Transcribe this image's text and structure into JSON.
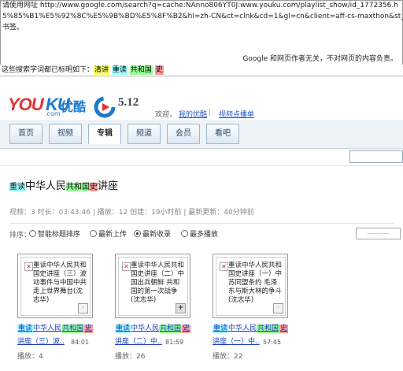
{
  "cache": {
    "url_lines": [
      "请使用网址 http://www.google.com/search?q=cache:NAnno806YT0J:www.youku.com/playlist_show/id_1772356.h",
      "5%85%B1%E5%92%8C%E5%9B%BD%E5%8F%B2&hl=zh-CN&ct=clnk&cd=1&gl=cn&client=aff-cs-maxthon&st_",
      "书签。"
    ],
    "disclaimer": "Google 和网页作者无关，不对网页的内容负责。",
    "terms_label": "这些搜索字词都已标明如下：",
    "terms": [
      "清讲",
      "重读",
      "共和国",
      "史"
    ]
  },
  "header": {
    "logo_you": "YOU",
    "logo_ku": "KU",
    "logo_cn": "优酷",
    "logo_com": ".com",
    "event_date": "5.12",
    "welcome": "欢迎，",
    "my_youku": "我的优酷",
    "separator": "|",
    "video_on_demand": "视频点播单"
  },
  "nav": {
    "tabs": [
      "首页",
      "视频",
      "专辑",
      "频道",
      "会员",
      "看吧"
    ],
    "active": "专辑"
  },
  "playlist": {
    "title_parts": [
      "重读",
      "中华人民",
      "共和国",
      "史",
      "讲座"
    ],
    "meta": "视频：3  时长：03:43:46  |  播放：12  创建：19小时前  |  最新更新：40分钟前"
  },
  "sort": {
    "label": "排序：",
    "options": [
      "智能标题排序",
      "最新上传",
      "最新收录",
      "最多播放"
    ],
    "selected": "最新收录",
    "select_value": "————"
  },
  "videos": [
    {
      "thumb_text": "重读中华人民共和国史讲座（三）波动事件与中国中共走上世界舞台(沈志华)",
      "title_parts": [
        "重读",
        "中华人民",
        "共和国",
        "史"
      ],
      "title_line2": "讲座（三）波..",
      "duration": "84:01",
      "plays_label": "播放：",
      "plays": "4",
      "corner": "·"
    },
    {
      "thumb_text": "重读中华人民共和国史讲座（二）中国出兵朝鲜 共和国的第一次战争(沈志华)",
      "title_parts": [
        "重读",
        "中华人民",
        "共和国",
        "史"
      ],
      "title_line2": "讲座（二）中..",
      "duration": "81:59",
      "plays_label": "播放：",
      "plays": "26",
      "corner": "+"
    },
    {
      "thumb_text": "重读中华人民共和国史讲座（一）中苏同盟条约 毛泽东与斯大林的争斗(沈志华)",
      "title_parts": [
        "重读",
        "中华人民",
        "共和国",
        "史"
      ],
      "title_line2": "讲座（一）中..",
      "duration": "57:45",
      "plays_label": "播放：",
      "plays": "22",
      "corner": "·"
    }
  ]
}
